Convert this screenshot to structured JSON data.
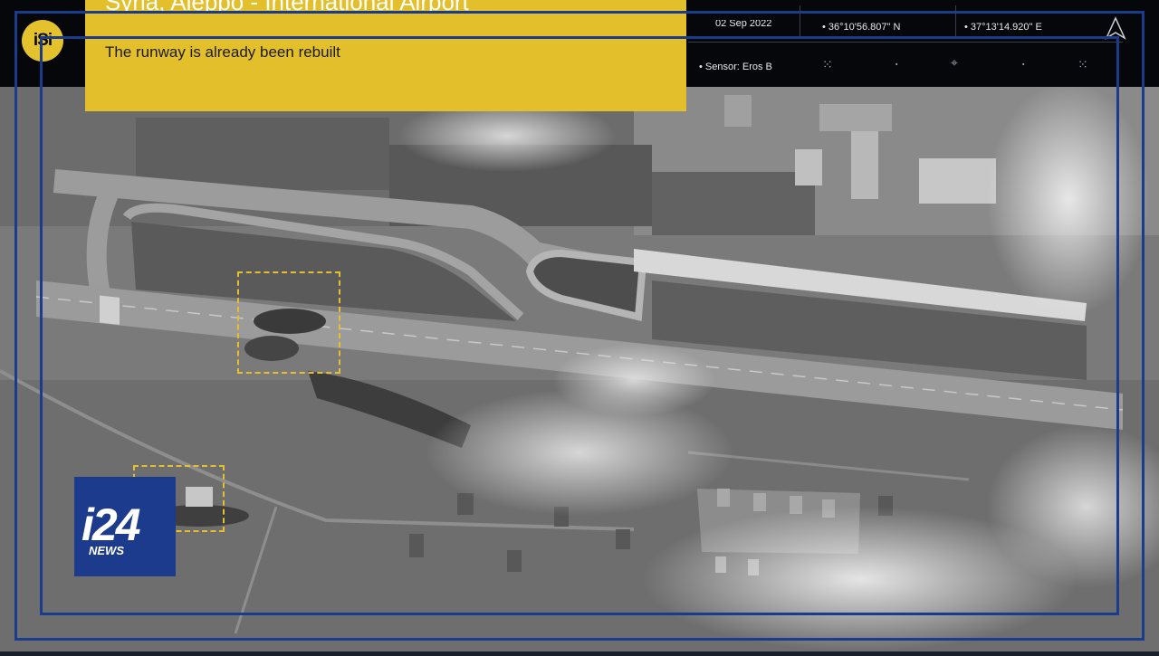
{
  "overlay": {
    "title": "Syria, Aleppo - International Airport",
    "subtitle": "The runway is already been rebuilt",
    "logo_text": "iSi",
    "date": "02 Sep 2022",
    "latitude": "36°10'56.807\" N",
    "longitude": "37°13'14.920\" E",
    "sensor": "Sensor: Eros B",
    "north_icon": "north-arrow-icon"
  },
  "broadcaster": {
    "logo_main": "i24",
    "logo_sub": "NEWS"
  },
  "colors": {
    "accent_yellow": "#e3bf2b",
    "frame_blue": "#1b3c8a",
    "top_bar": "#05070b"
  }
}
